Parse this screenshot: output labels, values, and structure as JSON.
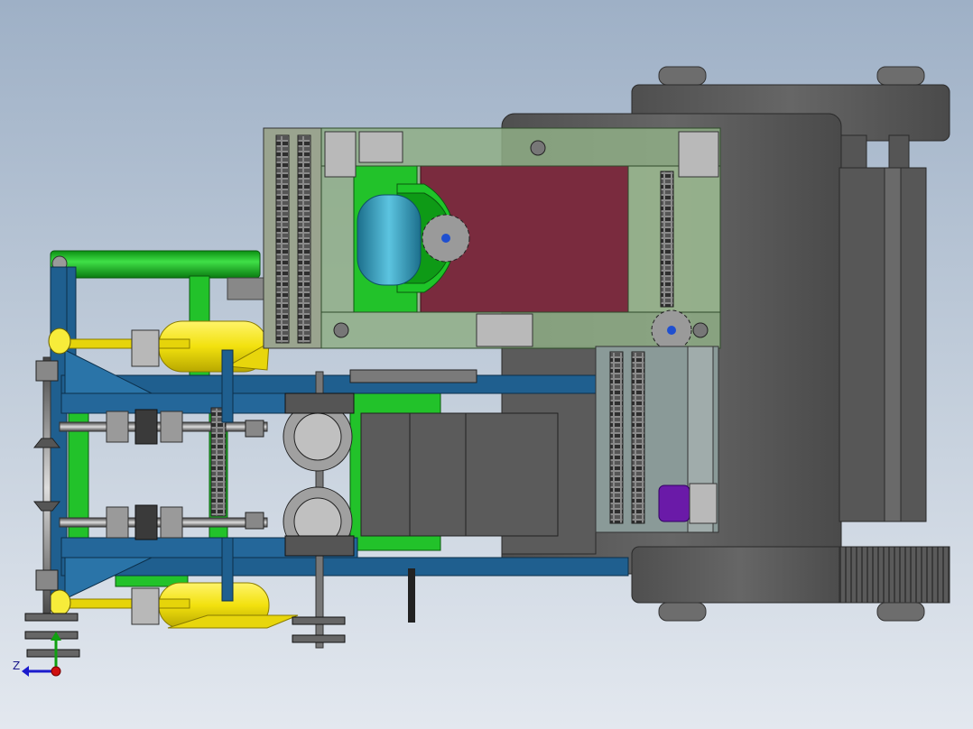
{
  "viewport": {
    "background_top": "#9eb0c6",
    "background_bottom": "#e3e8ef"
  },
  "triad": {
    "z_label": "Z",
    "colors": {
      "x": "#d01010",
      "y": "#10a010",
      "z": "#1a1acc"
    }
  },
  "colors": {
    "frame_blue": "#1f5f8f",
    "frame_green": "#22c22a",
    "hopper_maroon": "#7a2b3e",
    "translucent_frame": "#8fae86",
    "roller_yellow": "#f2e10e",
    "motor_purple": "#6a1aa8",
    "body_gray": "#5d5d5d",
    "auger_teal": "#3a9ab5",
    "chain_dark": "#3a3a3a"
  }
}
